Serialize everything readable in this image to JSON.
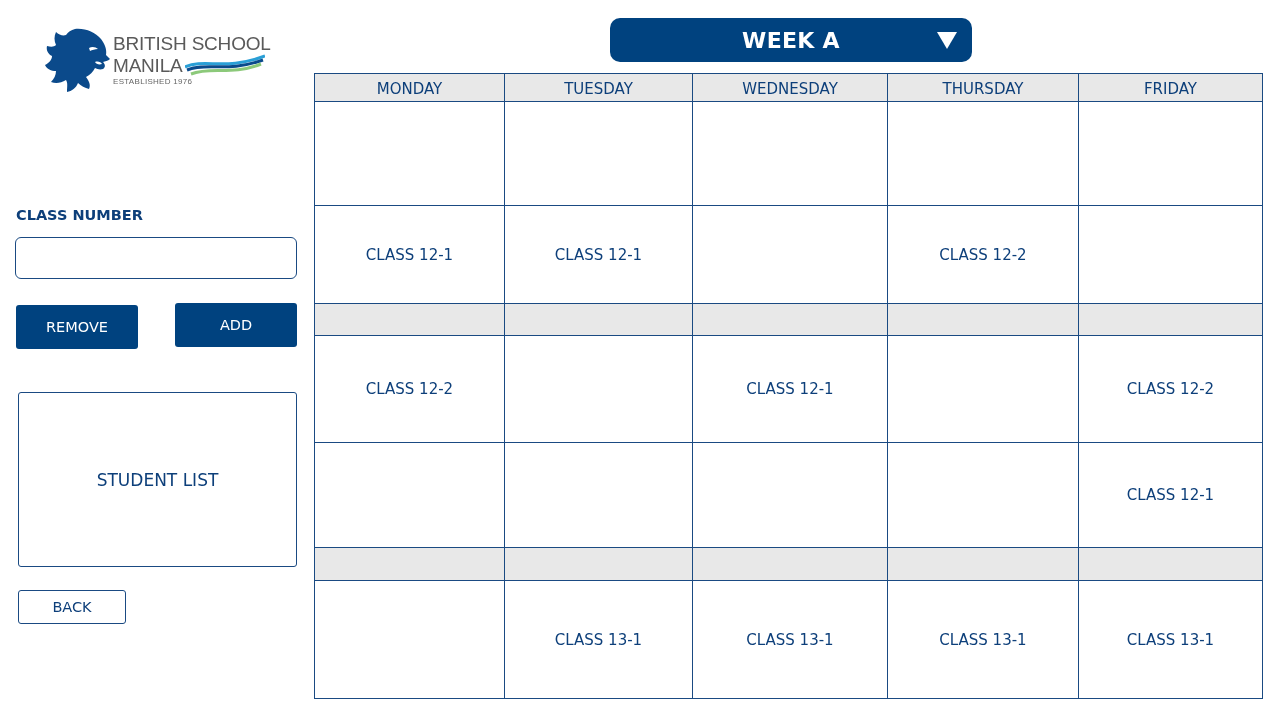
{
  "logo": {
    "name_line_1": "BRITISH SCHOOL",
    "name_line_2": "MANILA",
    "tagline": "ESTABLISHED 1976"
  },
  "class_number": {
    "label": "CLASS NUMBER"
  },
  "buttons": [
    {
      "label": "REMOVE"
    },
    {
      "label": "ADD"
    }
  ],
  "student_list": {
    "label": "STUDENT LIST"
  },
  "back_button": {
    "label": "BACK"
  },
  "week_selector": {
    "value": "WEEK A"
  },
  "timetable": {
    "columns": [
      "MONDAY",
      "TUESDAY",
      "WEDNESDAY",
      "THURSDAY",
      "FRIDAY"
    ],
    "rows": [
      {
        "kind": "period",
        "cells": [
          {
            "kind": "empty"
          },
          {
            "kind": "empty"
          },
          {
            "kind": "empty"
          },
          {
            "kind": "empty"
          },
          {
            "kind": "empty"
          }
        ]
      },
      {
        "kind": "period",
        "cells": [
          {
            "kind": "class",
            "text": "CLASS 12-1"
          },
          {
            "kind": "class",
            "text": "CLASS 12-1"
          },
          {
            "kind": "empty"
          },
          {
            "kind": "class",
            "text": "CLASS 12-2"
          },
          {
            "kind": "empty"
          }
        ]
      },
      {
        "kind": "break"
      },
      {
        "kind": "period",
        "cells": [
          {
            "kind": "class",
            "text": "CLASS 12-2"
          },
          {
            "kind": "empty"
          },
          {
            "kind": "class",
            "text": "CLASS 12-1"
          },
          {
            "kind": "empty"
          },
          {
            "kind": "class",
            "text": "CLASS 12-2"
          }
        ]
      },
      {
        "kind": "period",
        "cells": [
          {
            "kind": "empty"
          },
          {
            "kind": "empty"
          },
          {
            "kind": "empty"
          },
          {
            "kind": "empty"
          },
          {
            "kind": "class",
            "text": "CLASS 12-1"
          }
        ]
      },
      {
        "kind": "break"
      },
      {
        "kind": "period",
        "cells": [
          {
            "kind": "empty"
          },
          {
            "kind": "class",
            "text": "CLASS 13-1"
          },
          {
            "kind": "class",
            "text": "CLASS 13-1"
          },
          {
            "kind": "class",
            "text": "CLASS 13-1"
          },
          {
            "kind": "class",
            "text": "CLASS 13-1"
          }
        ]
      }
    ]
  }
}
